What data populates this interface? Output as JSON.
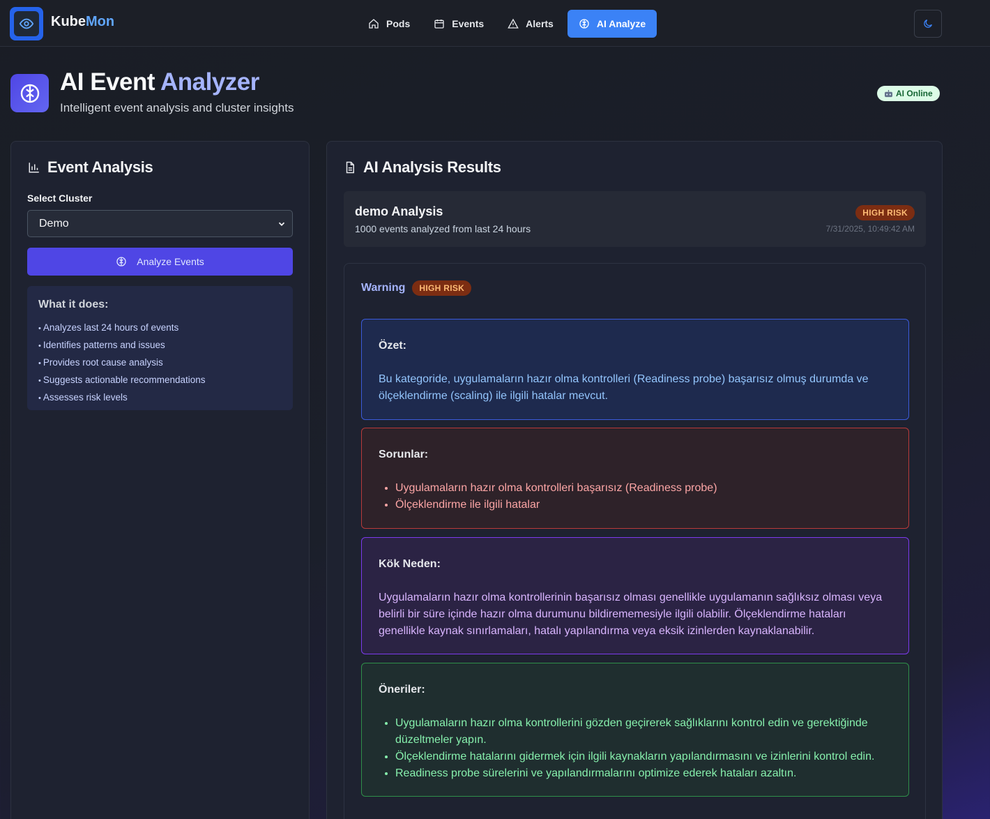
{
  "app": {
    "brand_prefix": "Kube",
    "brand_suffix": "Mon"
  },
  "nav": {
    "items": [
      {
        "label": "Pods",
        "icon": "home-icon"
      },
      {
        "label": "Events",
        "icon": "calendar-icon"
      },
      {
        "label": "Alerts",
        "icon": "warning-icon"
      },
      {
        "label": "AI Analyze",
        "icon": "brain-icon",
        "active": true
      }
    ],
    "theme_icon": "moon-icon"
  },
  "header": {
    "title_main": "AI Event ",
    "title_accent": "Analyzer",
    "subtitle": "Intelligent event analysis and cluster insights",
    "status": "AI Online"
  },
  "left": {
    "title": "Event Analysis",
    "select_label": "Select Cluster",
    "select_value": "Demo",
    "analyze_button": "Analyze Events",
    "info_title": "What it does:",
    "info_items": [
      "Analyzes last 24 hours of events",
      "Identifies patterns and issues",
      "Provides root cause analysis",
      "Suggests actionable recommendations",
      "Assesses risk levels"
    ]
  },
  "right": {
    "title": "AI Analysis Results",
    "summary": {
      "title": "demo Analysis",
      "subtitle": "1000 events analyzed from last 24 hours",
      "badge": "HIGH RISK",
      "timestamp": "7/31/2025, 10:49:42 AM"
    },
    "detail": {
      "type_label": "Warning",
      "badge": "HIGH RISK",
      "ozet_title": "Özet:",
      "ozet_text": "Bu kategoride, uygulamaların hazır olma kontrolleri (Readiness probe) başarısız olmuş durumda ve ölçeklendirme (scaling) ile ilgili hatalar mevcut.",
      "sorunlar_title": "Sorunlar:",
      "sorunlar": [
        "Uygulamaların hazır olma kontrolleri başarısız (Readiness probe)",
        "Ölçeklendirme ile ilgili hatalar"
      ],
      "kok_title": "Kök Neden:",
      "kok_text": "Uygulamaların hazır olma kontrollerinin başarısız olması genellikle uygulamanın sağlıksız olması veya belirli bir süre içinde hazır olma durumunu bildirememesiyle ilgili olabilir. Ölçeklendirme hataları genellikle kaynak sınırlamaları, hatalı yapılandırma veya eksik izinlerden kaynaklanabilir.",
      "oneriler_title": "Öneriler:",
      "oneriler": [
        "Uygulamaların hazır olma kontrollerini gözden geçirerek sağlıklarını kontrol edin ve gerektiğinde düzeltmeler yapın.",
        "Ölçeklendirme hatalarını gidermek için ilgili kaynakların yapılandırmasını ve izinlerini kontrol edin.",
        "Readiness probe sürelerini ve yapılandırmalarını optimize ederek hataları azaltın."
      ]
    }
  },
  "colors": {
    "accent": "#3b82f6",
    "primary_button": "#4f46e5",
    "risk_badge_bg": "#7c2d12",
    "risk_badge_text": "#fdba74"
  }
}
